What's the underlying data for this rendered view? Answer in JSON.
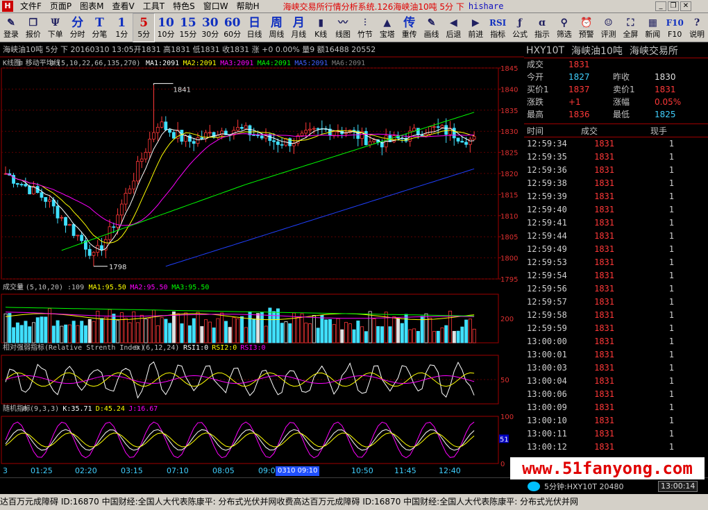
{
  "menubar": {
    "items": [
      "文件F",
      "页面P",
      "图表M",
      "查看V",
      "工具T",
      "特色S",
      "窗口W",
      "帮助H"
    ],
    "title": "海峡交易所行情分析系统.126海峡油10吨 5分 下",
    "title_suffix": "hishare"
  },
  "toolbar": [
    {
      "glyph": "✎",
      "label": "登录",
      "icon": "login-icon"
    },
    {
      "glyph": "❐",
      "label": "报价",
      "icon": "quote-icon"
    },
    {
      "glyph": "Ψ",
      "label": "下单",
      "icon": "order-icon"
    },
    {
      "glyph": "分",
      "label": "分时"
    },
    {
      "glyph": "T",
      "label": "分笔"
    },
    {
      "glyph": "1",
      "label": "1分"
    },
    {
      "glyph": "5",
      "label": "5分",
      "active": true
    },
    {
      "glyph": "10",
      "label": "10分"
    },
    {
      "glyph": "15",
      "label": "15分"
    },
    {
      "glyph": "30",
      "label": "30分"
    },
    {
      "glyph": "60",
      "label": "60分"
    },
    {
      "glyph": "日",
      "label": "日线"
    },
    {
      "glyph": "周",
      "label": "周线"
    },
    {
      "glyph": "月",
      "label": "月线"
    },
    {
      "glyph": "▮",
      "label": "K线",
      "icon": "kline-icon"
    },
    {
      "glyph": "〰",
      "label": "线图",
      "icon": "linechart-icon"
    },
    {
      "glyph": "⫶",
      "label": "竹节",
      "icon": "bamboo-icon"
    },
    {
      "glyph": "▲",
      "label": "宝塔",
      "icon": "tower-icon"
    },
    {
      "glyph": "传",
      "label": "重传"
    },
    {
      "glyph": "✎",
      "label": "画线",
      "icon": "draw-icon"
    },
    {
      "glyph": "◀",
      "label": "后退",
      "icon": "back-icon"
    },
    {
      "glyph": "▶",
      "label": "前进",
      "icon": "forward-icon"
    },
    {
      "glyph": "RSI",
      "label": "指标"
    },
    {
      "glyph": "ƒ",
      "label": "公式",
      "icon": "formula-icon"
    },
    {
      "glyph": "ɑ",
      "label": "指示",
      "icon": "indicate-icon"
    },
    {
      "glyph": "⚲",
      "label": "筛选",
      "icon": "filter-icon"
    },
    {
      "glyph": "⏰",
      "label": "预警",
      "icon": "alarm-icon"
    },
    {
      "glyph": "☺",
      "label": "评测",
      "icon": "review-icon"
    },
    {
      "glyph": "⛶",
      "label": "全屏",
      "icon": "fullscreen-icon"
    },
    {
      "glyph": "▦",
      "label": "新闻",
      "icon": "news-icon"
    },
    {
      "glyph": "F10",
      "label": "F10"
    },
    {
      "glyph": "?",
      "label": "说明",
      "icon": "help-icon"
    }
  ],
  "chart_header": "海峡油10吨 5分 下 20160310 13:05开1831 高1831 低1831 收1831 涨 +0 0.00% 量9 额16488 20552",
  "price_panel": {
    "name": "K线图",
    "indicator": "移动平均线",
    "params": "(5,10,22,66,135,270)",
    "ma": [
      {
        "label": "MA1:2091",
        "color": "#ffffff"
      },
      {
        "label": "MA2:2091",
        "color": "#ffff00"
      },
      {
        "label": "MA3:2091",
        "color": "#ff00ff"
      },
      {
        "label": "MA4:2091",
        "color": "#00ff00"
      },
      {
        "label": "MA5:2091",
        "color": "#4060ff"
      },
      {
        "label": "MA6:2091",
        "color": "#808080"
      }
    ],
    "annotations": [
      "1841",
      "1798"
    ],
    "y_ticks": [
      "1845",
      "1840",
      "1835",
      "1830",
      "1825",
      "1820",
      "1815",
      "1810",
      "1805",
      "1800",
      "1795"
    ]
  },
  "volume_panel": {
    "name": "成交量",
    "params": "(5,10,20)",
    "value": ":109",
    "ma": [
      {
        "label": "MA1:95.50",
        "color": "#ffff00"
      },
      {
        "label": "MA2:95.50",
        "color": "#ff00ff"
      },
      {
        "label": "MA3:95.50",
        "color": "#00ff00"
      }
    ],
    "y_tick": "200"
  },
  "rsi_panel": {
    "name": "相对强弱指标(Relative Strenth Index)",
    "params": "(6,12,24)",
    "values": [
      {
        "label": "RSI1:0",
        "color": "#ffffff"
      },
      {
        "label": "RSI2:0",
        "color": "#ffff00"
      },
      {
        "label": "RSI3:0",
        "color": "#ff00ff"
      }
    ],
    "y_tick": "50"
  },
  "kdj_panel": {
    "name": "随机指标",
    "params": "(9,3,3)",
    "values": [
      {
        "label": "K:35.71",
        "color": "#ffffff"
      },
      {
        "label": "D:45.24",
        "color": "#ffff00"
      },
      {
        "label": "J:16.67",
        "color": "#ff00ff"
      }
    ],
    "y_ticks": [
      "100",
      "50",
      "0"
    ],
    "marker": "51"
  },
  "time_axis": {
    "labels": [
      "3",
      "01:25",
      "02:20",
      "03:15",
      "07:10",
      "08:05",
      "09:00",
      "09:10",
      "10:50",
      "11:45",
      "12:40"
    ],
    "highlight": "0310 09:10"
  },
  "right_panel": {
    "header": [
      "HXY10T",
      "海峡油10吨",
      "海峡交易所"
    ],
    "quote_rows": [
      [
        {
          "k": "成交",
          "v": "1831",
          "c": "red"
        }
      ],
      [
        {
          "k": "今开",
          "v": "1827",
          "c": "cyan"
        },
        {
          "k": "昨收",
          "v": "1830",
          "c": "white"
        }
      ],
      [
        {
          "k": "买价1",
          "v": "1837",
          "c": "red"
        },
        {
          "k": "卖价1",
          "v": "1831",
          "c": "red"
        }
      ],
      [
        {
          "k": "涨跌",
          "v": "+1",
          "c": "red"
        },
        {
          "k": "涨幅",
          "v": "0.05%",
          "c": "red"
        }
      ],
      [
        {
          "k": "最高",
          "v": "1836",
          "c": "red"
        },
        {
          "k": "最低",
          "v": "1825",
          "c": "cyan"
        }
      ]
    ],
    "ticks_header": [
      "时间",
      "成交",
      "现手"
    ],
    "ticks": [
      {
        "t": "12:59:34",
        "p": "1831",
        "q": "1"
      },
      {
        "t": "12:59:35",
        "p": "1831",
        "q": "1"
      },
      {
        "t": "12:59:36",
        "p": "1831",
        "q": "1"
      },
      {
        "t": "12:59:38",
        "p": "1831",
        "q": "1"
      },
      {
        "t": "12:59:39",
        "p": "1831",
        "q": "1"
      },
      {
        "t": "12:59:40",
        "p": "1831",
        "q": "1"
      },
      {
        "t": "12:59:41",
        "p": "1831",
        "q": "1"
      },
      {
        "t": "12:59:44",
        "p": "1831",
        "q": "1"
      },
      {
        "t": "12:59:49",
        "p": "1831",
        "q": "1"
      },
      {
        "t": "12:59:53",
        "p": "1831",
        "q": "1"
      },
      {
        "t": "12:59:54",
        "p": "1831",
        "q": "1"
      },
      {
        "t": "12:59:56",
        "p": "1831",
        "q": "1"
      },
      {
        "t": "12:59:57",
        "p": "1831",
        "q": "1"
      },
      {
        "t": "12:59:58",
        "p": "1831",
        "q": "1"
      },
      {
        "t": "12:59:59",
        "p": "1831",
        "q": "1"
      },
      {
        "t": "13:00:00",
        "p": "1831",
        "q": "1"
      },
      {
        "t": "13:00:01",
        "p": "1831",
        "q": "1"
      },
      {
        "t": "13:00:03",
        "p": "1831",
        "q": "1"
      },
      {
        "t": "13:00:04",
        "p": "1831",
        "q": "1"
      },
      {
        "t": "13:00:06",
        "p": "1831",
        "q": "1"
      },
      {
        "t": "13:00:09",
        "p": "1831",
        "q": "1"
      },
      {
        "t": "13:00:10",
        "p": "1831",
        "q": "1"
      },
      {
        "t": "13:00:11",
        "p": "1831",
        "q": "1"
      },
      {
        "t": "13:00:12",
        "p": "1831",
        "q": "1"
      }
    ]
  },
  "status": {
    "info": "5分钟:HXY10T  20480",
    "time": "13:00:14"
  },
  "ticker": "达百万元成障碍 ID:16870    中国财经:全国人大代表陈康平: 分布式光伏并网收费高达百万元成障碍 ID:16870    中国财经:全国人大代表陈康平: 分布式光伏并网",
  "watermark": "www.51fanyong.com"
}
